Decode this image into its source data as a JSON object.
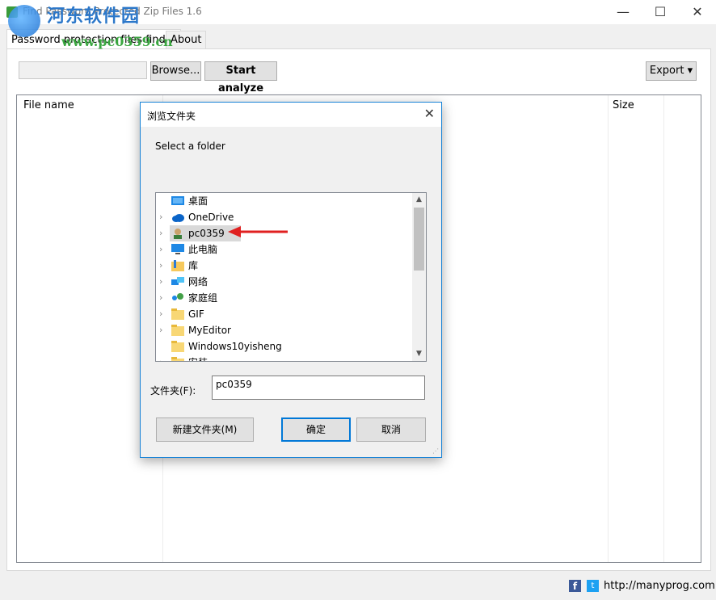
{
  "window": {
    "title": "Find Password Protected Zip Files 1.6",
    "watermark": "河东软件园",
    "watermark_url": "www.pc0359.cn",
    "minimize": "—",
    "maximize": "☐",
    "close": "✕"
  },
  "tabs": [
    {
      "label": "Password protection files finder"
    },
    {
      "label": "About"
    }
  ],
  "toolbar": {
    "path_value": "",
    "browse_label": "Browse...",
    "analyze_label": "Start analyze",
    "export_label": "Export ▾"
  },
  "results": {
    "columns": [
      "File name",
      "Size"
    ]
  },
  "footer": {
    "link": "http://manyprog.com"
  },
  "dialog": {
    "title": "浏览文件夹",
    "description": "Select a folder",
    "tree": [
      {
        "label": "桌面",
        "icon": "desktop-icon",
        "expandable": false,
        "selected": false
      },
      {
        "label": "OneDrive",
        "icon": "cloud-icon",
        "expandable": true,
        "selected": false
      },
      {
        "label": "pc0359",
        "icon": "user-icon",
        "expandable": true,
        "selected": true
      },
      {
        "label": "此电脑",
        "icon": "computer-icon",
        "expandable": true,
        "selected": false
      },
      {
        "label": "库",
        "icon": "library-icon",
        "expandable": true,
        "selected": false
      },
      {
        "label": "网络",
        "icon": "network-icon",
        "expandable": true,
        "selected": false
      },
      {
        "label": "家庭组",
        "icon": "homegroup-icon",
        "expandable": true,
        "selected": false
      },
      {
        "label": "GIF",
        "icon": "folder-icon",
        "expandable": true,
        "selected": false
      },
      {
        "label": "MyEditor",
        "icon": "folder-icon",
        "expandable": true,
        "selected": false
      },
      {
        "label": "Windows10yisheng",
        "icon": "folder-icon",
        "expandable": false,
        "selected": false
      },
      {
        "label": "安装",
        "icon": "folder-icon",
        "expandable": true,
        "selected": false
      }
    ],
    "folder_label": "文件夹(F):",
    "folder_value": "pc0359",
    "new_folder_label": "新建文件夹(M)",
    "ok_label": "确定",
    "cancel_label": "取消"
  },
  "colors": {
    "accent": "#0078d7",
    "annotation_arrow": "#e02020"
  }
}
